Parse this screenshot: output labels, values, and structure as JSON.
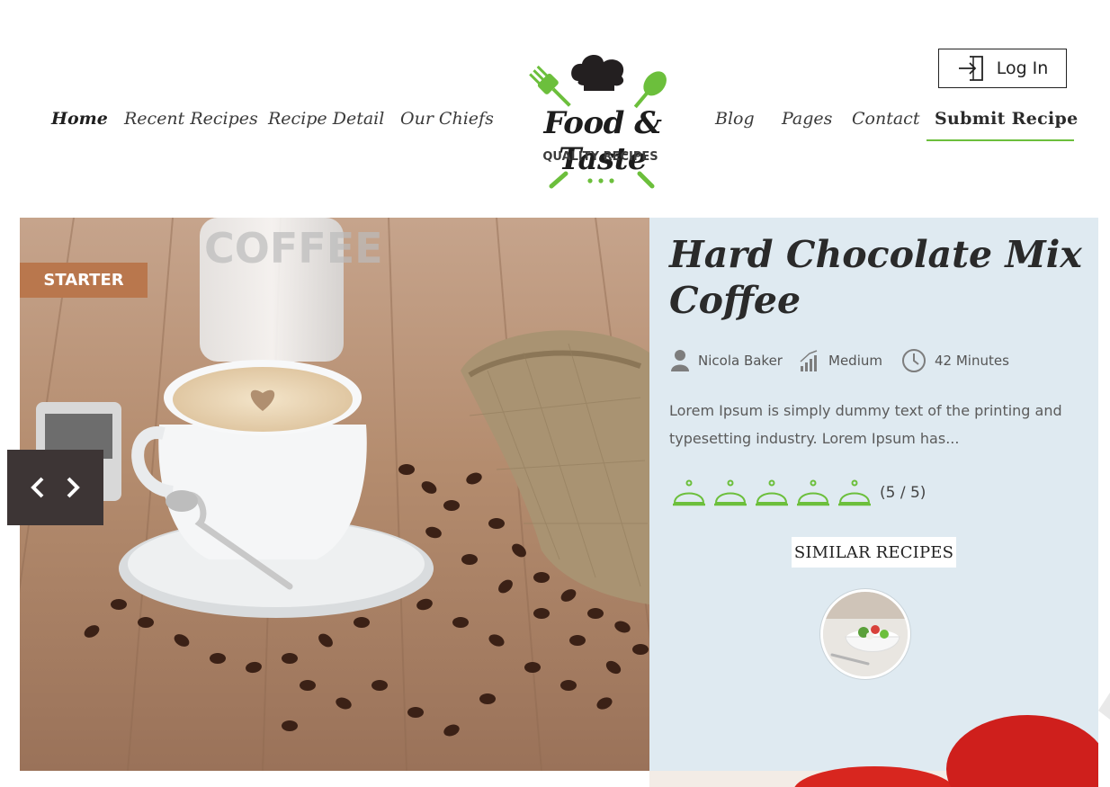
{
  "header": {
    "login_label": "Log In",
    "logo": {
      "word": "Food & Taste",
      "tagline": "QUALITY RECIPES"
    },
    "nav": [
      {
        "label": "Home",
        "active": true
      },
      {
        "label": "Recent Recipes"
      },
      {
        "label": "Recipe Detail"
      },
      {
        "label": "Our Chiefs"
      },
      {
        "label": "Blog"
      },
      {
        "label": "Pages"
      },
      {
        "label": "Contact"
      },
      {
        "label": "Submit Recipe",
        "highlighted": true
      }
    ]
  },
  "hero": {
    "category": "STARTER",
    "title": "Hard Chocolate Mix Coffee",
    "author": "Nicola Baker",
    "difficulty": "Medium",
    "duration": "42 Minutes",
    "excerpt": "Lorem Ipsum is simply dummy text of the printing and typesetting industry. Lorem Ipsum has...",
    "rating": {
      "value": 5,
      "max": 5,
      "text": "(5 / 5)",
      "icon": "cloche-icon"
    },
    "similar_label": "SIMILAR RECIPES",
    "prev_icon": "chevron-left-icon",
    "next_icon": "chevron-right-icon"
  },
  "colors": {
    "accent_green": "#6cbf3c",
    "badge": "#b9774d",
    "panel_bg": "#dfeaf1",
    "slider_bg": "#3d3535"
  }
}
